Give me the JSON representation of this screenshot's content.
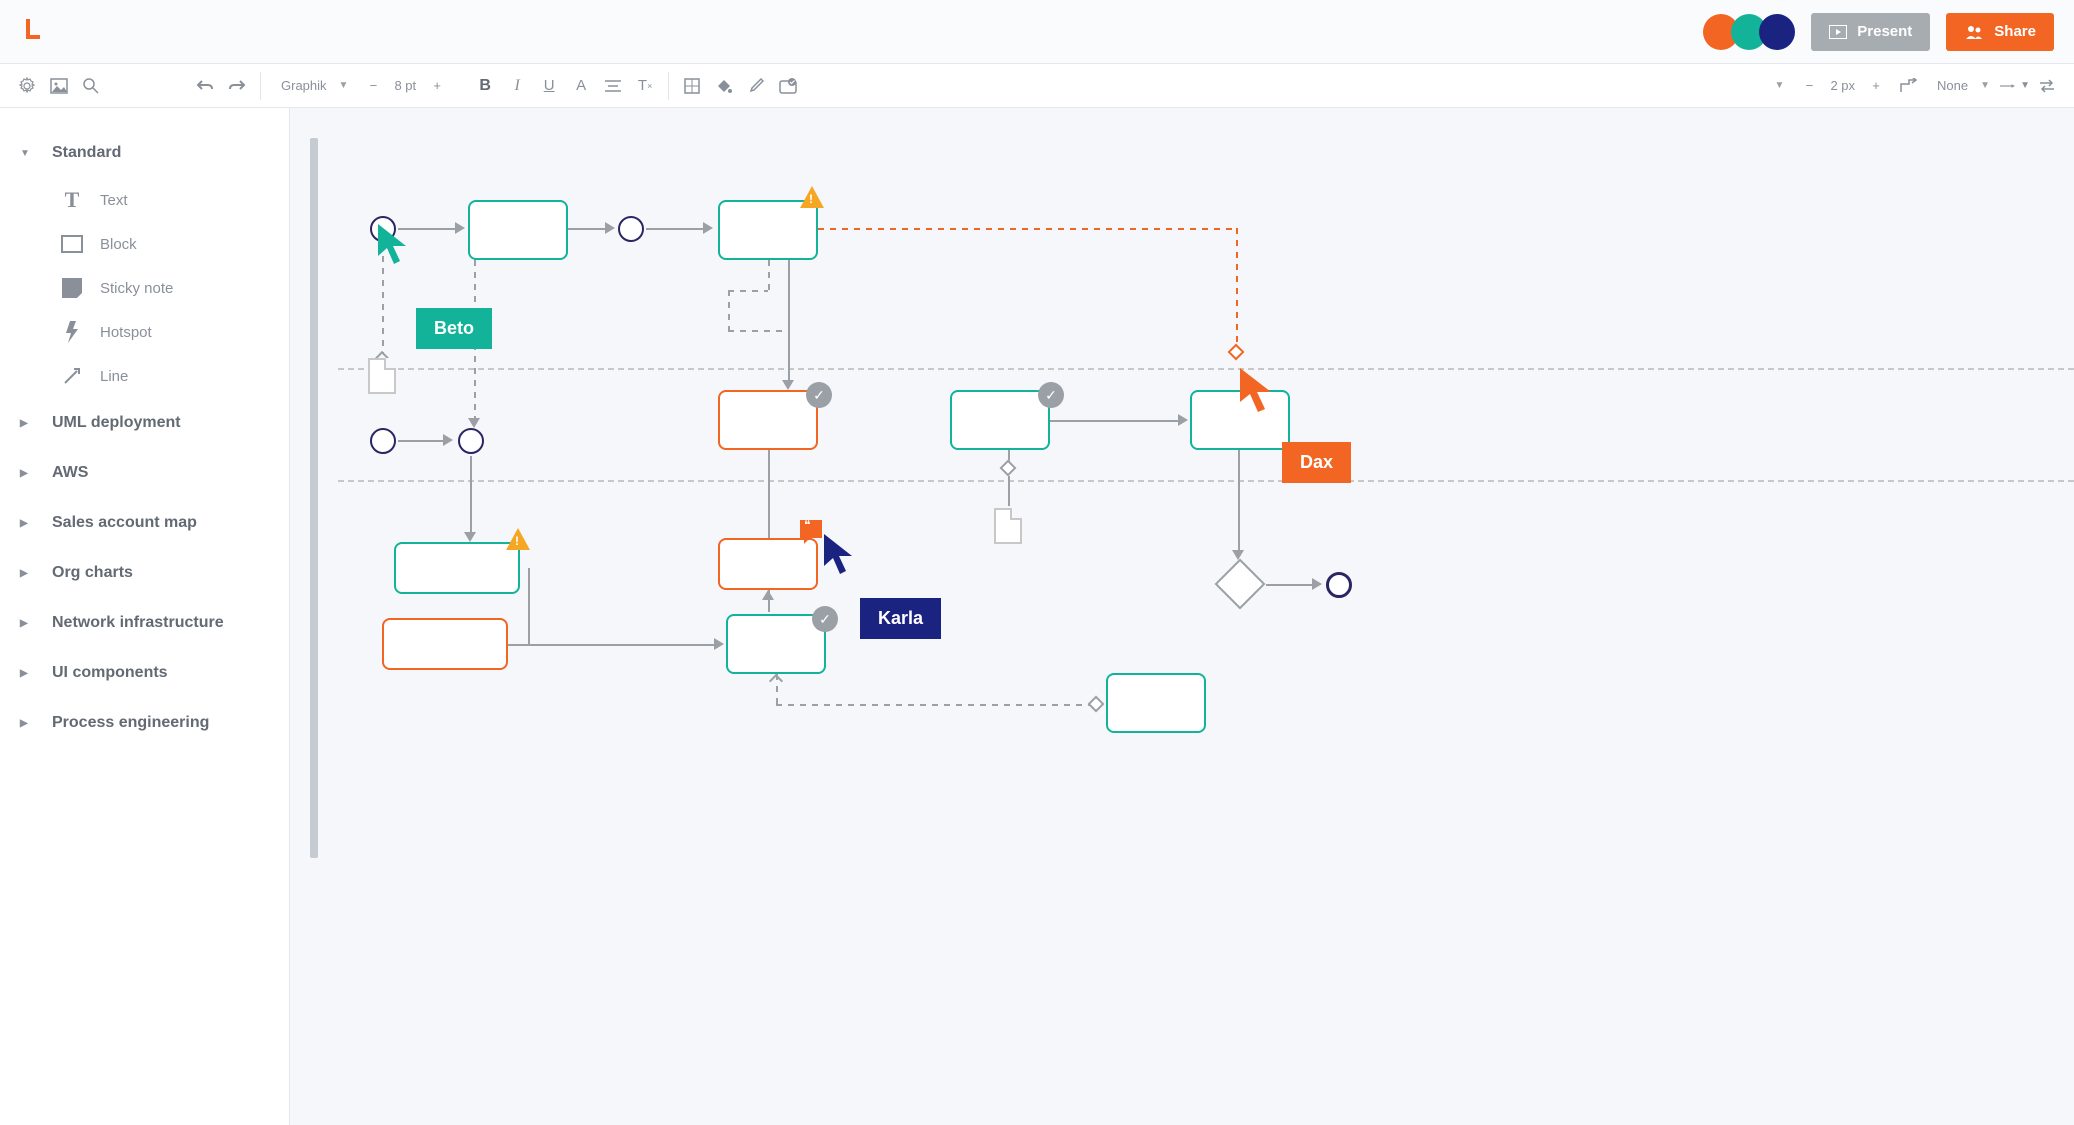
{
  "header": {
    "present_label": "Present",
    "share_label": "Share"
  },
  "collaborators": [
    "Beto",
    "Karla",
    "Dax"
  ],
  "toolbar": {
    "font_family": "Graphik",
    "font_size": "8 pt",
    "stroke_width": "2 px",
    "arrow_style": "None"
  },
  "sidebar": {
    "sections": [
      {
        "label": "Standard",
        "expanded": true,
        "items": [
          {
            "label": "Text"
          },
          {
            "label": "Block"
          },
          {
            "label": "Sticky note"
          },
          {
            "label": "Hotspot"
          },
          {
            "label": "Line"
          }
        ]
      },
      {
        "label": "UML deployment",
        "expanded": false
      },
      {
        "label": "AWS",
        "expanded": false
      },
      {
        "label": "Sales account map",
        "expanded": false
      },
      {
        "label": "Org charts",
        "expanded": false
      },
      {
        "label": "Network infrastructure",
        "expanded": false
      },
      {
        "label": "UI components",
        "expanded": false
      },
      {
        "label": "Process engineering",
        "expanded": false
      }
    ]
  },
  "canvas_users": {
    "beto": "Beto",
    "karla": "Karla",
    "dax": "Dax"
  }
}
